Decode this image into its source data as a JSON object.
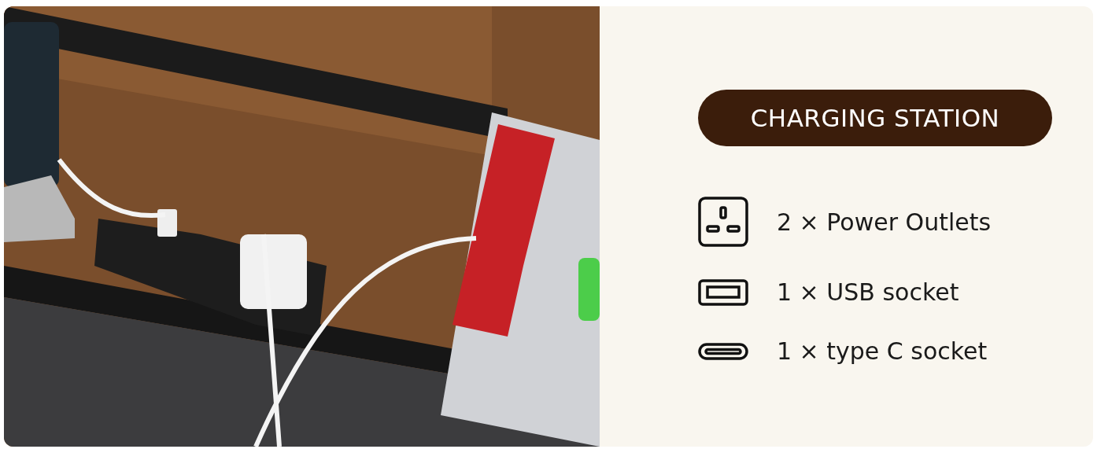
{
  "badge": "CHARGING STATION",
  "features": [
    {
      "kind": "outlet",
      "text": "2 × Power Outlets"
    },
    {
      "kind": "usb",
      "text": "1 × USB socket"
    },
    {
      "kind": "typec",
      "text": "1 × type C socket"
    }
  ]
}
